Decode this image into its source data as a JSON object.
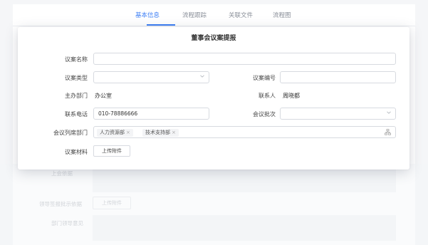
{
  "tabs": [
    {
      "label": "基本信息",
      "active": true
    },
    {
      "label": "流程跟踪",
      "active": false
    },
    {
      "label": "关联文件",
      "active": false
    },
    {
      "label": "流程图",
      "active": false
    }
  ],
  "background": {
    "basis_label": "上会依据",
    "approval_label": "领导签报批示依据",
    "approval_upload": "上传附件",
    "opinion_label": "部门领导意见"
  },
  "dialog": {
    "title": "董事会议案提报",
    "fields": {
      "name_label": "议案名称",
      "name_value": "",
      "type_label": "议案类型",
      "type_value": "",
      "number_label": "议案编号",
      "number_value": "",
      "dept_label": "主办部门",
      "dept_value": "办公室",
      "contact_label": "联系人",
      "contact_value": "周晓都",
      "phone_label": "联系电话",
      "phone_value": "010-78886666",
      "batch_label": "会议批次",
      "batch_value": "",
      "attend_label": "会议列席部门",
      "attend_tags": [
        "人力资源部",
        "技术支持部"
      ],
      "material_label": "议案材料",
      "upload_label": "上传附件"
    }
  },
  "colors": {
    "accent": "#3d7ff5",
    "border": "#d7dae0"
  }
}
